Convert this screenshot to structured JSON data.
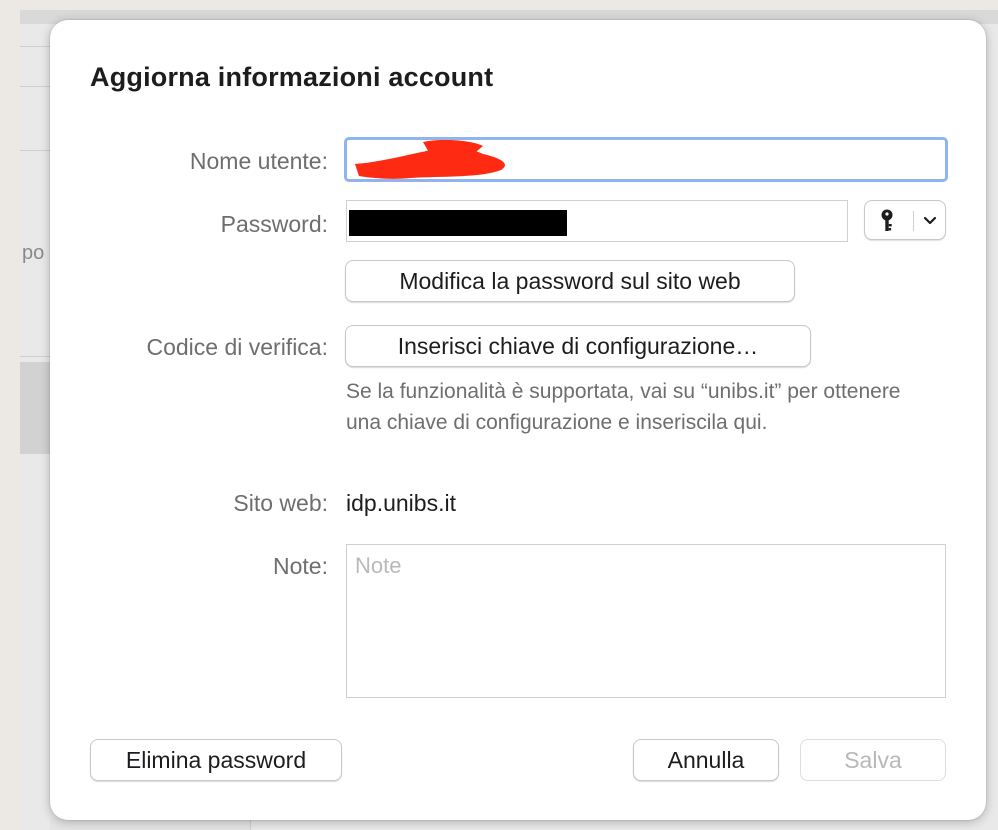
{
  "background": {
    "partial_text": "po"
  },
  "dialog": {
    "title": "Aggiorna informazioni account",
    "username": {
      "label": "Nome utente:",
      "value": "",
      "redacted": true,
      "redaction_color": "#ff2a12"
    },
    "password": {
      "label": "Password:",
      "value": "",
      "redacted": true,
      "redaction_color": "#000000",
      "key_menu_icon": "key-icon",
      "chevron_icon": "chevron-down-icon"
    },
    "change_password_button": "Modifica la password sul sito web",
    "verification": {
      "label": "Codice di verifica:",
      "button": "Inserisci chiave di configurazione…",
      "helper_text": "Se la funzionalità è supportata, vai su “unibs.it” per ottenere una chiave di configurazione e inseriscila qui."
    },
    "website": {
      "label": "Sito web:",
      "value": "idp.unibs.it"
    },
    "notes": {
      "label": "Note:",
      "placeholder": "Note",
      "value": ""
    },
    "buttons": {
      "delete": "Elimina password",
      "cancel": "Annulla",
      "save": "Salva",
      "save_enabled": false
    }
  },
  "colors": {
    "focus_ring": "#8fb4ef",
    "label": "#6e6e70",
    "text": "#1d1d1f",
    "disabled": "#b8b8b8"
  }
}
